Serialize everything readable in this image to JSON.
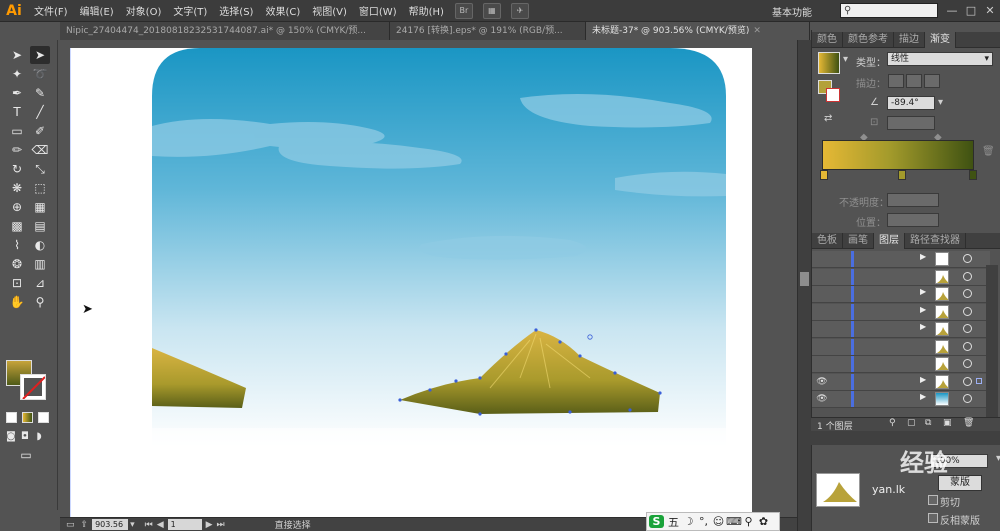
{
  "app": {
    "logo": "Ai",
    "menus": [
      "文件(F)",
      "编辑(E)",
      "对象(O)",
      "文字(T)",
      "选择(S)",
      "效果(C)",
      "视图(V)",
      "窗口(W)",
      "帮助(H)"
    ],
    "bridge_label": "Br",
    "workspace": "基本功能",
    "window_min": "—",
    "window_max": "□",
    "window_close": "✕"
  },
  "tabs": [
    {
      "label": "Nipic_27404474_20180818232531744087.ai* @ 150% (CMYK/预...",
      "active": false
    },
    {
      "label": "24176 [转换].eps* @ 191% (RGB/预...",
      "active": false
    },
    {
      "label": "未标题-37* @ 903.56% (CMYK/预览)",
      "active": true
    }
  ],
  "tab_close": "✕",
  "tools": [
    {
      "name": "selection-tool",
      "glyph": "➤"
    },
    {
      "name": "direct-selection-tool",
      "glyph": "➤"
    },
    {
      "name": "magic-wand-tool",
      "glyph": "✦"
    },
    {
      "name": "lasso-tool",
      "glyph": "➰"
    },
    {
      "name": "pen-tool",
      "glyph": "✒"
    },
    {
      "name": "curvature-tool",
      "glyph": "✎"
    },
    {
      "name": "type-tool",
      "glyph": "T"
    },
    {
      "name": "line-tool",
      "glyph": "╱"
    },
    {
      "name": "rectangle-tool",
      "glyph": "▭"
    },
    {
      "name": "paintbrush-tool",
      "glyph": "✐"
    },
    {
      "name": "pencil-tool",
      "glyph": "✏"
    },
    {
      "name": "eraser-tool",
      "glyph": "⌫"
    },
    {
      "name": "rotate-tool",
      "glyph": "↻"
    },
    {
      "name": "scale-tool",
      "glyph": "⤡"
    },
    {
      "name": "warp-tool",
      "glyph": "❋"
    },
    {
      "name": "free-transform-tool",
      "glyph": "⬚"
    },
    {
      "name": "shape-builder-tool",
      "glyph": "⊕"
    },
    {
      "name": "chart-tool",
      "glyph": "▦"
    },
    {
      "name": "mesh-tool",
      "glyph": "▩"
    },
    {
      "name": "gradient-tool",
      "glyph": "▤"
    },
    {
      "name": "eyedropper-tool",
      "glyph": "⌇"
    },
    {
      "name": "blend-tool",
      "glyph": "◐"
    },
    {
      "name": "symbol-sprayer-tool",
      "glyph": "❂"
    },
    {
      "name": "column-graph-tool",
      "glyph": "▥"
    },
    {
      "name": "artboard-tool",
      "glyph": "⊡"
    },
    {
      "name": "slice-tool",
      "glyph": "⊿"
    },
    {
      "name": "hand-tool",
      "glyph": "✋"
    },
    {
      "name": "zoom-tool",
      "glyph": "⚲"
    }
  ],
  "status": {
    "zoom": "903.56",
    "page": "1",
    "tool_label": "直接选择"
  },
  "panel_top": {
    "tabs": [
      "颜色",
      "颜色参考",
      "描边",
      "渐变"
    ],
    "active_tab": 3,
    "type_label": "类型：",
    "type_value": "线性",
    "stroke_label": "描边：",
    "angle_value": "-89.4°",
    "opacity_label": "不透明度：",
    "position_label": "位置："
  },
  "panel_layers": {
    "tabs": [
      "色板",
      "画笔",
      "图层",
      "路径查找器"
    ],
    "active_tab": 2,
    "row_count": 9,
    "layer_count_label": "1 个图层"
  },
  "ime": {
    "brand": "S",
    "glyphs": [
      "五",
      "☽",
      "°,",
      "☺",
      "⌨",
      "⚲",
      "✿"
    ]
  },
  "watermark": {
    "text": "经验",
    "sub": "yan.lk",
    "partial_label": "100%",
    "mask_button": "蒙版",
    "clip_label": "剪切",
    "invert_label": "反相蒙版"
  },
  "colors": {
    "sky_top": "#1e9bc7",
    "sky_bottom": "#ffffff",
    "mountain_light": "#d4b040",
    "mountain_dark": "#5c5a18",
    "gradient_start": "#e5b835",
    "gradient_end": "#3f5212",
    "anchor": "#3a5fd8"
  }
}
